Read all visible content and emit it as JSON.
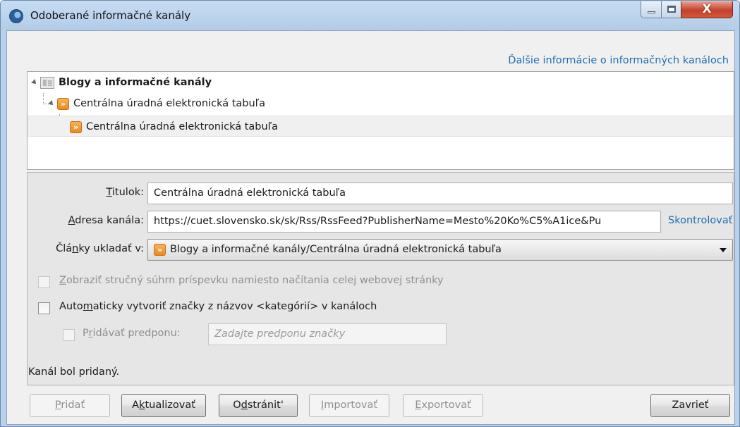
{
  "window": {
    "title": "Odoberané informačné kanály",
    "controls": {
      "close_glyph": "X"
    }
  },
  "more_info_link": "Ďalšie informácie o informačných kanáloch",
  "tree": {
    "items": [
      {
        "label": "Blogy a informačné kanály",
        "icon": "folder-icon",
        "bold": true
      },
      {
        "label": "Centrálna úradná elektronická tabuľa",
        "icon": "rss-icon"
      },
      {
        "label": "Centrálna úradná elektronická tabuľa",
        "icon": "rss-icon",
        "selected": true
      }
    ]
  },
  "form": {
    "title_label_ul": "T",
    "title_label_rest": "itulok:",
    "title_value": "Centrálna úradná elektronická tabuľa",
    "address_label_ul": "A",
    "address_label_rest": "dresa kanála:",
    "address_value": "https://cuet.slovensko.sk/sk/Rss/RssFeed?PublisherName=Mesto%20Ko%C5%A1ice&Pu",
    "verify_link": "Skontrolovať",
    "store_label_pre": "Člá",
    "store_label_ul": "n",
    "store_label_post": "ky ukladať v:",
    "store_value": "Blogy a informačné kanály/Centrálna úradná elektronická tabuľa",
    "summary_ul": "Z",
    "summary_rest": "obraziť stručný súhrn príspevku namiesto načítania celej webovej stránky",
    "autotag_pre": "Auto",
    "autotag_ul": "m",
    "autotag_post": "aticky vytvoriť značky z názvov <kategórií> v kanáloch",
    "prefix_pre": "P",
    "prefix_ul": "r",
    "prefix_post": "idávať predponu:",
    "prefix_placeholder": "Zadajte predponu značky"
  },
  "status": "Kanál bol pridaný.",
  "buttons": {
    "add_ul": "P",
    "add_rest": "ridať",
    "update_pre": "A",
    "update_ul": "k",
    "update_post": "tualizovať",
    "remove_pre": "O",
    "remove_ul": "d",
    "remove_post": "stránit'",
    "import_ul": "I",
    "import_rest": "mportovať",
    "export_ul": "E",
    "export_rest": "xportovať",
    "close": "Zavrieť"
  }
}
